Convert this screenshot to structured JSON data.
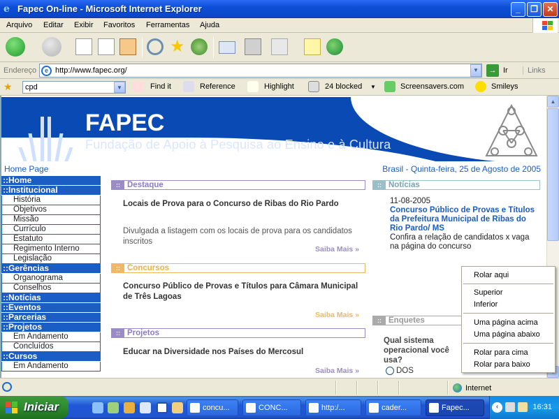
{
  "window": {
    "title": "Fapec On-line - Microsoft Internet Explorer",
    "buttons": {
      "minimize": "_",
      "maximize": "❐",
      "close": "✕"
    }
  },
  "menu": [
    "Arquivo",
    "Editar",
    "Exibir",
    "Favoritos",
    "Ferramentas",
    "Ajuda"
  ],
  "address": {
    "label": "Endereço",
    "url": "http://www.fapec.org/",
    "go": "Ir",
    "links": "Links"
  },
  "toolbar2": {
    "search_value": "cpd",
    "find": "Find it",
    "reference": "Reference",
    "highlight": "Highlight",
    "blocked": "24 blocked",
    "screensavers": "Screensavers.com",
    "smileys": "Smileys"
  },
  "banner": {
    "org": "FAPEC",
    "fullname": "Fundação de Apoio à Pesquisa ao Ensino e à Cultura"
  },
  "page": {
    "home": "Home Page",
    "date": "Brasil - Quinta-feira, 25 de Agosto de 2005"
  },
  "nav": [
    {
      "type": "head",
      "label": "::Home"
    },
    {
      "type": "head",
      "label": "::Institucional"
    },
    {
      "type": "item",
      "label": "História"
    },
    {
      "type": "item",
      "label": "Objetivos"
    },
    {
      "type": "item",
      "label": "Missão"
    },
    {
      "type": "item",
      "label": "Currículo"
    },
    {
      "type": "item",
      "label": "Estatuto"
    },
    {
      "type": "item",
      "label": "Regimento Interno"
    },
    {
      "type": "item",
      "label": "Legislação"
    },
    {
      "type": "head",
      "label": "::Gerências"
    },
    {
      "type": "item",
      "label": "Organograma"
    },
    {
      "type": "item",
      "label": "Conselhos"
    },
    {
      "type": "head",
      "label": "::Notícias"
    },
    {
      "type": "head",
      "label": "::Eventos"
    },
    {
      "type": "head",
      "label": "::Parcerias"
    },
    {
      "type": "head",
      "label": "::Projetos"
    },
    {
      "type": "item",
      "label": "Em Andamento"
    },
    {
      "type": "item",
      "label": "Concluídos"
    },
    {
      "type": "head",
      "label": "::Cursos"
    },
    {
      "type": "item",
      "label": "Em Andamento"
    }
  ],
  "sections": {
    "destaque": {
      "label": "Destaque",
      "title": "Locais de Prova para o Concurso de Ribas do Rio Pardo",
      "text": "Divulgada a listagem com os locais de prova para os candidatos inscritos",
      "more": "Saiba Mais »"
    },
    "concursos": {
      "label": "Concursos",
      "title": "Concurso Público de Provas e Títulos para Câmara Municipal de Três Lagoas",
      "more": "Saiba Mais »"
    },
    "projetos": {
      "label": "Projetos",
      "title": "Educar na Diversidade nos Países do Mercosul",
      "more": "Saiba Mais »"
    },
    "noticias": {
      "label": "Notícias",
      "date": "11-08-2005",
      "title": "Concurso Público de Provas e Títulos da Prefeitura Municipal de Ribas do Rio Pardo/ MS",
      "text": "Confira a relação de candidatos x vaga na página do concurso"
    },
    "enquetes": {
      "label": "Enquetes",
      "question": "Qual sistema operacional você usa?",
      "option": "DOS"
    }
  },
  "context_menu": [
    "Rolar aqui",
    "Superior",
    "Inferior",
    "Uma página acima",
    "Uma página abaixo",
    "Rolar para cima",
    "Rolar para baixo"
  ],
  "status": {
    "zone": "Internet"
  },
  "taskbar": {
    "start": "Iniciar",
    "tasks": [
      "concu...",
      "CONC...",
      "http:/...",
      "cader...",
      "Fapec..."
    ],
    "clock": "16:31"
  }
}
